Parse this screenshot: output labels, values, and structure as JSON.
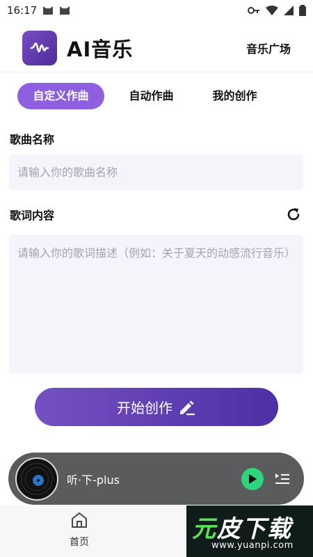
{
  "status_bar": {
    "time": "16:17"
  },
  "header": {
    "title": "AI音乐",
    "plaza_link": "音乐广场"
  },
  "tabs": [
    {
      "label": "自定义作曲",
      "active": true
    },
    {
      "label": "自动作曲",
      "active": false
    },
    {
      "label": "我的创作",
      "active": false
    }
  ],
  "form": {
    "name_label": "歌曲名称",
    "name_placeholder": "请输入你的歌曲名称",
    "lyrics_label": "歌词内容",
    "lyrics_placeholder": "请输入你的歌词描述（例如：关于夏天的动感流行音乐）"
  },
  "create_button": {
    "label": "开始创作"
  },
  "player": {
    "title": "听·下-plus"
  },
  "bottom_nav": {
    "home_label": "首页"
  },
  "watermark": {
    "text_green": "元",
    "text_white": "皮下载",
    "url": "www.yuanpi.com"
  },
  "colors": {
    "accent": "#8e5fe0",
    "button": "#6142b5",
    "play": "#2cd67a",
    "input_bg": "#f4f4fb"
  }
}
